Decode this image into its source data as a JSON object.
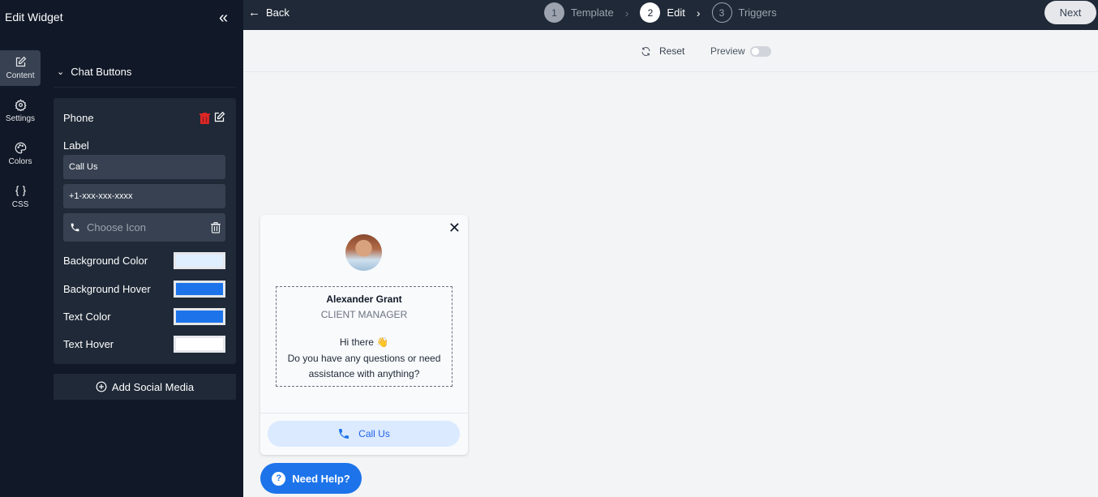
{
  "sidebar": {
    "title": "Edit Widget",
    "collapse_icon": "double-chevron-left-icon",
    "nav": [
      {
        "label": "Content",
        "icon": "edit-icon",
        "active": true
      },
      {
        "label": "Settings",
        "icon": "gear-icon",
        "active": false
      },
      {
        "label": "Colors",
        "icon": "palette-icon",
        "active": false
      },
      {
        "label": "CSS",
        "icon": "braces-icon",
        "active": false
      }
    ],
    "section_title": "Chat Buttons",
    "card": {
      "title": "Phone",
      "label_heading": "Label",
      "label_value": "Call Us",
      "phone_value": "+1-xxx-xxx-xxxx",
      "icon_placeholder": "Choose Icon",
      "colors": [
        {
          "label": "Background Color",
          "value": "#e0efff"
        },
        {
          "label": "Background Hover",
          "value": "#1d74ea"
        },
        {
          "label": "Text Color",
          "value": "#1d74ea"
        },
        {
          "label": "Text Hover",
          "value": "#ffffff"
        }
      ]
    },
    "add_social_label": "Add Social Media"
  },
  "topbar": {
    "back_label": "Back",
    "steps": [
      {
        "num": "1",
        "label": "Template",
        "state": "done"
      },
      {
        "num": "2",
        "label": "Edit",
        "state": "current"
      },
      {
        "num": "3",
        "label": "Triggers",
        "state": "next"
      }
    ],
    "next_label": "Next"
  },
  "toolbar": {
    "reset_label": "Reset",
    "preview_label": "Preview",
    "preview_on": false
  },
  "widget": {
    "name": "Alexander Grant",
    "role": "CLIENT MANAGER",
    "greeting_line1": "Hi there 👋",
    "greeting_line2": "Do you have any questions or need assistance with anything?",
    "call_button_label": "Call Us",
    "help_button_label": "Need Help?"
  },
  "colors": {
    "accent": "#1d74ea",
    "danger": "#dc2626"
  }
}
